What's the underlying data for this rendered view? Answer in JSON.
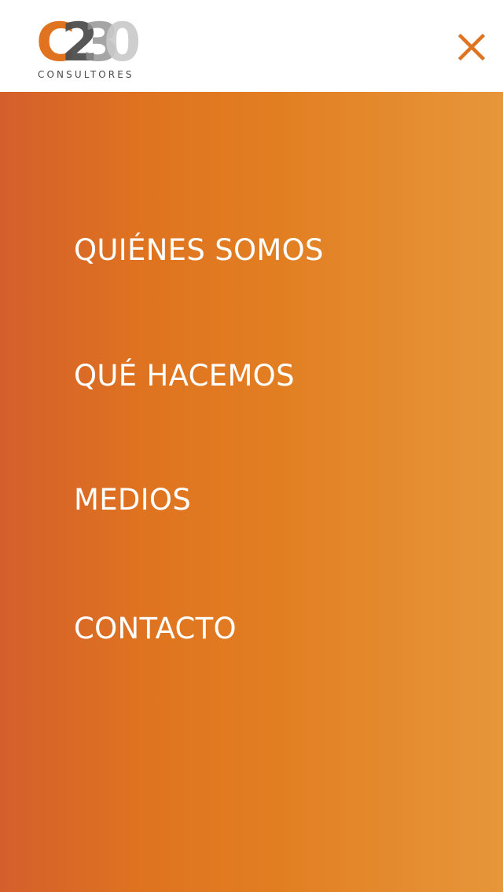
{
  "header": {
    "logo": {
      "mark_text": "C230",
      "subtitle": "CONSULTORES",
      "colors": {
        "orange": "#e07320",
        "dark_gray": "#4f4f4f",
        "light_gray": "#c9c9c9"
      }
    },
    "close_icon": "close-icon",
    "close_color": "#e07320"
  },
  "menu": {
    "background_colors": [
      "#d45f2c",
      "#df7320",
      "#e27e22",
      "#e7963a"
    ],
    "text_color": "#ffffff",
    "items": [
      {
        "label": "QUIÉNES SOMOS"
      },
      {
        "label": "QUÉ HACEMOS"
      },
      {
        "label": "MEDIOS"
      },
      {
        "label": "CONTACTO"
      }
    ]
  }
}
